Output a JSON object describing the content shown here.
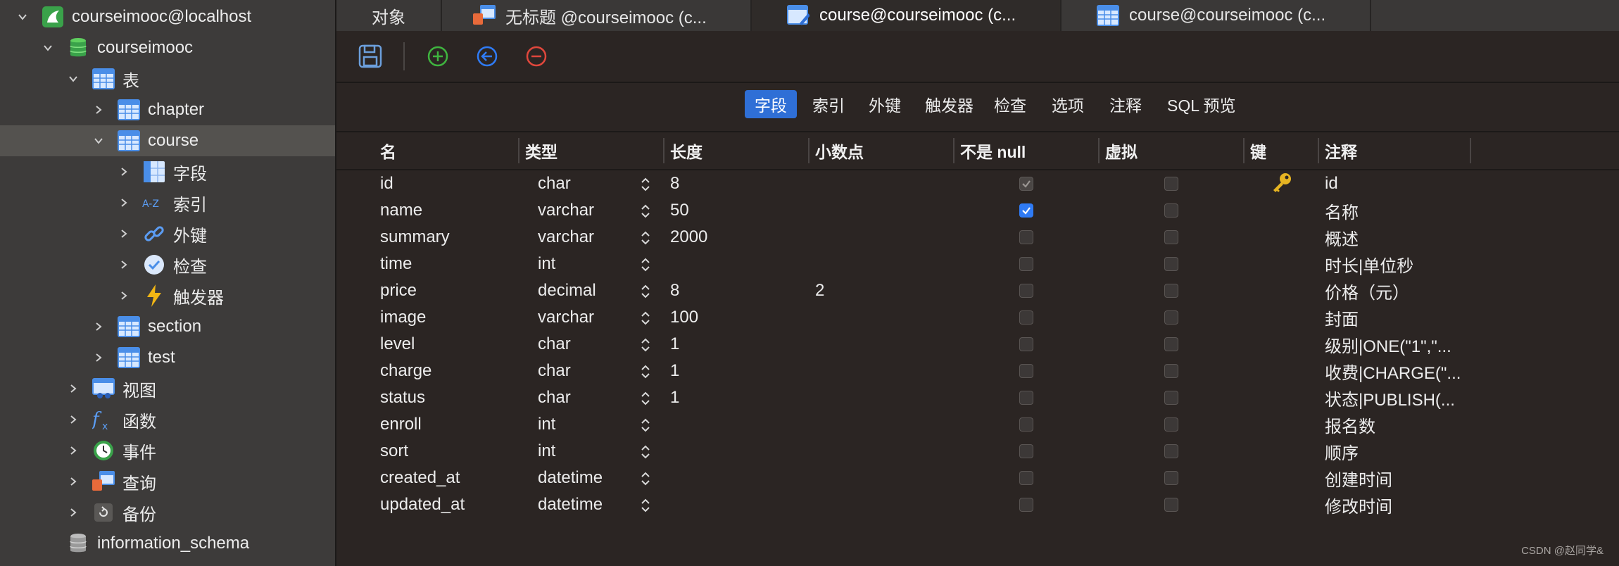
{
  "sidebar": {
    "items": [
      {
        "label": "courseimooc@localhost",
        "icon": "server-connection-icon",
        "expanded": true
      },
      {
        "label": "courseimooc",
        "icon": "database-icon",
        "expanded": true
      },
      {
        "label": "表",
        "icon": "tables-folder-icon",
        "expanded": true
      },
      {
        "label": "chapter",
        "icon": "table-icon",
        "expanded": false
      },
      {
        "label": "course",
        "icon": "table-icon",
        "expanded": true,
        "selected": true
      },
      {
        "label": "字段",
        "icon": "fields-icon",
        "expanded": false
      },
      {
        "label": "索引",
        "icon": "index-az-icon",
        "expanded": false
      },
      {
        "label": "外键",
        "icon": "link-icon",
        "expanded": false
      },
      {
        "label": "检查",
        "icon": "check-circle-icon",
        "expanded": false
      },
      {
        "label": "触发器",
        "icon": "lightning-icon",
        "expanded": false
      },
      {
        "label": "section",
        "icon": "table-icon",
        "expanded": false
      },
      {
        "label": "test",
        "icon": "table-icon",
        "expanded": false
      },
      {
        "label": "视图",
        "icon": "view-icon",
        "expanded": false
      },
      {
        "label": "函数",
        "icon": "function-icon",
        "expanded": false
      },
      {
        "label": "事件",
        "icon": "clock-icon",
        "expanded": false
      },
      {
        "label": "查询",
        "icon": "query-icon",
        "expanded": false
      },
      {
        "label": "备份",
        "icon": "backup-icon",
        "expanded": false
      },
      {
        "label": "information_schema",
        "icon": "database-gray-icon",
        "expanded": false
      }
    ]
  },
  "tabs": [
    {
      "label": "对象",
      "icon": ""
    },
    {
      "label": "无标题 @courseimooc (c...",
      "icon": "query-icon"
    },
    {
      "label": "course@courseimooc (c...",
      "icon": "table-design-icon",
      "active": true
    },
    {
      "label": "course@courseimooc (c...",
      "icon": "table-icon"
    }
  ],
  "toolbar": {
    "buttons": [
      "save-icon",
      "add-icon",
      "back-icon",
      "remove-icon"
    ]
  },
  "subtabs": [
    "字段",
    "索引",
    "外键",
    "触发器",
    "检查",
    "选项",
    "注释",
    "SQL 预览"
  ],
  "grid": {
    "columns": [
      "名",
      "类型",
      "长度",
      "小数点",
      "不是 null",
      "虚拟",
      "键",
      "注释"
    ],
    "rows": [
      {
        "name": "id",
        "type": "char",
        "length": "8",
        "decimals": "",
        "not_null": "checked-dim",
        "virtual": false,
        "key": true,
        "comment": "id"
      },
      {
        "name": "name",
        "type": "varchar",
        "length": "50",
        "decimals": "",
        "not_null": "checked",
        "virtual": false,
        "key": false,
        "comment": "名称"
      },
      {
        "name": "summary",
        "type": "varchar",
        "length": "2000",
        "decimals": "",
        "not_null": "",
        "virtual": false,
        "key": false,
        "comment": "概述"
      },
      {
        "name": "time",
        "type": "int",
        "length": "",
        "decimals": "",
        "not_null": "",
        "virtual": false,
        "key": false,
        "comment": "时长|单位秒"
      },
      {
        "name": "price",
        "type": "decimal",
        "length": "8",
        "decimals": "2",
        "not_null": "",
        "virtual": false,
        "key": false,
        "comment": "价格（元）"
      },
      {
        "name": "image",
        "type": "varchar",
        "length": "100",
        "decimals": "",
        "not_null": "",
        "virtual": false,
        "key": false,
        "comment": "封面"
      },
      {
        "name": "level",
        "type": "char",
        "length": "1",
        "decimals": "",
        "not_null": "",
        "virtual": false,
        "key": false,
        "comment": "级别|ONE(\"1\",\"..."
      },
      {
        "name": "charge",
        "type": "char",
        "length": "1",
        "decimals": "",
        "not_null": "",
        "virtual": false,
        "key": false,
        "comment": "收费|CHARGE(\"..."
      },
      {
        "name": "status",
        "type": "char",
        "length": "1",
        "decimals": "",
        "not_null": "",
        "virtual": false,
        "key": false,
        "comment": "状态|PUBLISH(..."
      },
      {
        "name": "enroll",
        "type": "int",
        "length": "",
        "decimals": "",
        "not_null": "",
        "virtual": false,
        "key": false,
        "comment": "报名数"
      },
      {
        "name": "sort",
        "type": "int",
        "length": "",
        "decimals": "",
        "not_null": "",
        "virtual": false,
        "key": false,
        "comment": "顺序"
      },
      {
        "name": "created_at",
        "type": "datetime",
        "length": "",
        "decimals": "",
        "not_null": "",
        "virtual": false,
        "key": false,
        "comment": "创建时间"
      },
      {
        "name": "updated_at",
        "type": "datetime",
        "length": "",
        "decimals": "",
        "not_null": "",
        "virtual": false,
        "key": false,
        "comment": "修改时间"
      }
    ]
  },
  "watermark": "CSDN @赵同学&",
  "colors": {
    "accent": "#2f6fd6",
    "checkbox": "#2f7bf5",
    "add": "#3fb43f",
    "back": "#2f7bf5",
    "remove": "#e0473c",
    "key": "#e6b422"
  }
}
